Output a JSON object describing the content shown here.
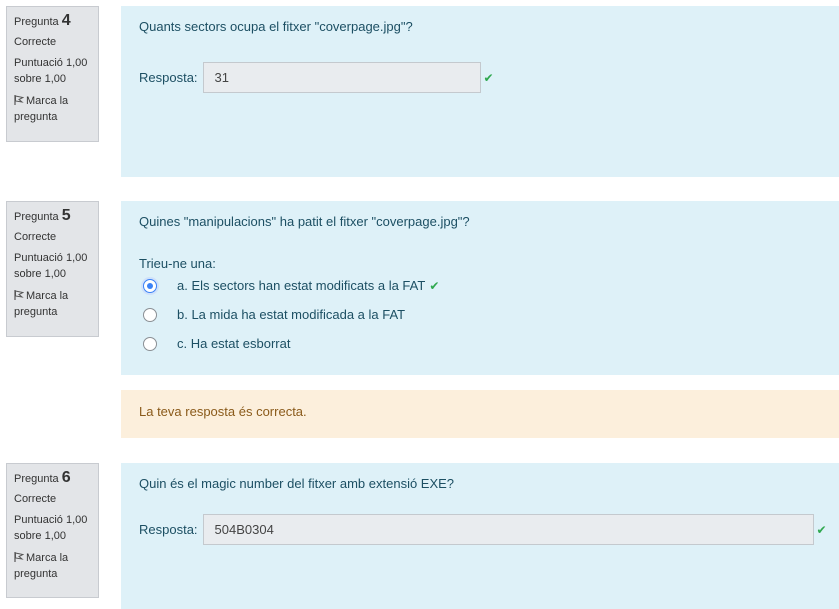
{
  "questions": [
    {
      "label": "Pregunta",
      "number": "4",
      "state": "Correcte",
      "grade_line1": "Puntuació 1,00",
      "grade_line2": "sobre 1,00",
      "flag_line1": "Marca la",
      "flag_line2": "pregunta",
      "text": "Quants sectors ocupa el fitxer \"coverpage.jpg\"?",
      "answer_label": "Resposta:",
      "answer_value": "31"
    },
    {
      "label": "Pregunta",
      "number": "5",
      "state": "Correcte",
      "grade_line1": "Puntuació 1,00",
      "grade_line2": "sobre 1,00",
      "flag_line1": "Marca la",
      "flag_line2": "pregunta",
      "text": "Quines \"manipulacions\" ha patit el fitxer \"coverpage.jpg\"?",
      "prompt": "Trieu-ne una:",
      "options": [
        {
          "text": "a. Els sectors han estat modificats a la FAT",
          "selected": true
        },
        {
          "text": "b. La mida ha estat modificada a la FAT",
          "selected": false
        },
        {
          "text": "c. Ha estat esborrat",
          "selected": false
        }
      ],
      "feedback": "La teva resposta és correcta."
    },
    {
      "label": "Pregunta",
      "number": "6",
      "state": "Correcte",
      "grade_line1": "Puntuació 1,00",
      "grade_line2": "sobre 1,00",
      "flag_line1": "Marca la",
      "flag_line2": "pregunta",
      "text": "Quin és el magic number del fitxer amb extensió EXE?",
      "answer_label": "Resposta:",
      "answer_value": "504B0304"
    }
  ],
  "colors": {
    "correct": "#2fa84f",
    "content_bg": "#def1f8",
    "feedback_bg": "#fcefdc",
    "info_bg": "#e3e5e8"
  }
}
